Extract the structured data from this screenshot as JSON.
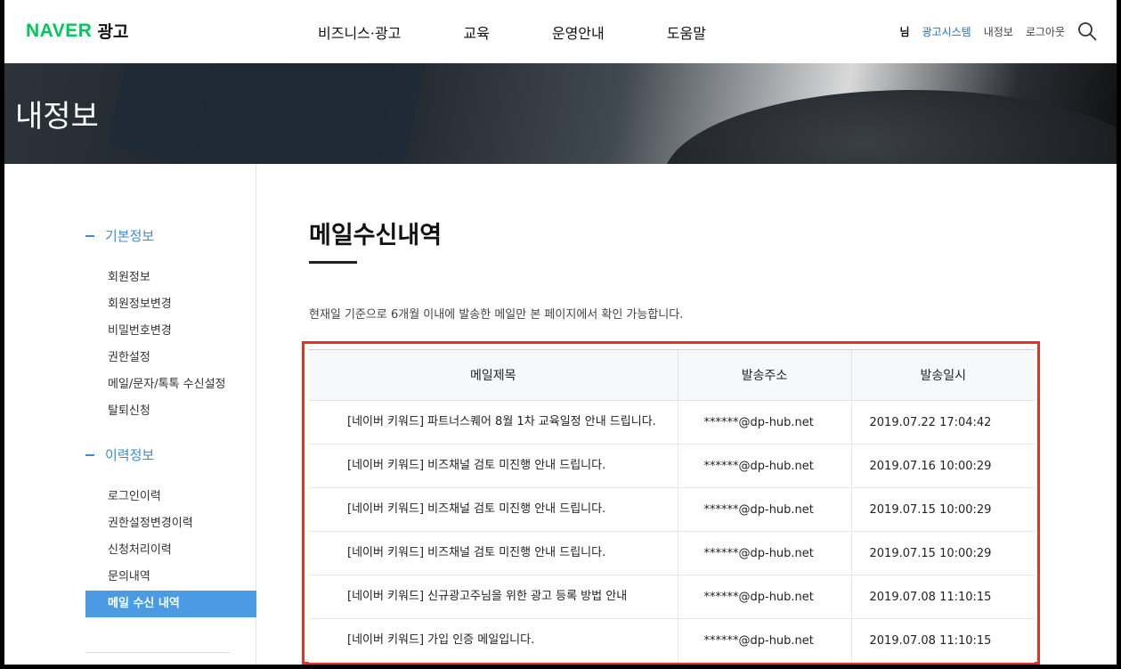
{
  "header": {
    "logo_brand": "NAVER",
    "logo_suffix": "광고",
    "nav": [
      "비즈니스·광고",
      "교육",
      "운영안내",
      "도움말"
    ],
    "user_suffix": "님",
    "util_ad_system": "광고시스템",
    "util_my_info": "내정보",
    "util_logout": "로그아웃"
  },
  "hero": {
    "title": "내정보"
  },
  "sidebar": {
    "groups": [
      {
        "title": "기본정보",
        "items": [
          "회원정보",
          "회원정보변경",
          "비밀번호변경",
          "권한설정",
          "메일/문자/톡톡 수신설정",
          "탈퇴신청"
        ]
      },
      {
        "title": "이력정보",
        "items": [
          "로그인이력",
          "권한설정변경이력",
          "신청처리이력",
          "문의내역",
          "메일 수신 내역"
        ]
      }
    ],
    "active_item": "메일 수신 내역"
  },
  "main": {
    "title": "메일수신내역",
    "notice": "현재일 기준으로 6개월 이내에 발송한 메일만 본 페이지에서 확인 가능합니다.",
    "table": {
      "headers": [
        "메일제목",
        "발송주소",
        "발송일시"
      ],
      "rows": [
        {
          "subject": "[네이버 키워드] 파트너스퀘어 8월 1차 교육일정 안내 드립니다.",
          "address": "******@dp-hub.net",
          "date": "2019.07.22 17:04:42"
        },
        {
          "subject": "[네이버 키워드] 비즈채널 검토 미진행 안내 드립니다.",
          "address": "******@dp-hub.net",
          "date": "2019.07.16 10:00:29"
        },
        {
          "subject": "[네이버 키워드] 비즈채널 검토 미진행 안내 드립니다.",
          "address": "******@dp-hub.net",
          "date": "2019.07.15 10:00:29"
        },
        {
          "subject": "[네이버 키워드] 비즈채널 검토 미진행 안내 드립니다.",
          "address": "******@dp-hub.net",
          "date": "2019.07.15 10:00:29"
        },
        {
          "subject": "[네이버 키워드] 신규광고주님을 위한 광고 등록 방법 안내",
          "address": "******@dp-hub.net",
          "date": "2019.07.08 11:10:15"
        },
        {
          "subject": "[네이버 키워드] 가입 인증 메일입니다.",
          "address": "******@dp-hub.net",
          "date": "2019.07.08 11:10:15"
        }
      ]
    }
  },
  "colors": {
    "brand_green": "#03c75a",
    "accent_blue": "#4a9be3",
    "highlight_red": "#e4321f"
  }
}
